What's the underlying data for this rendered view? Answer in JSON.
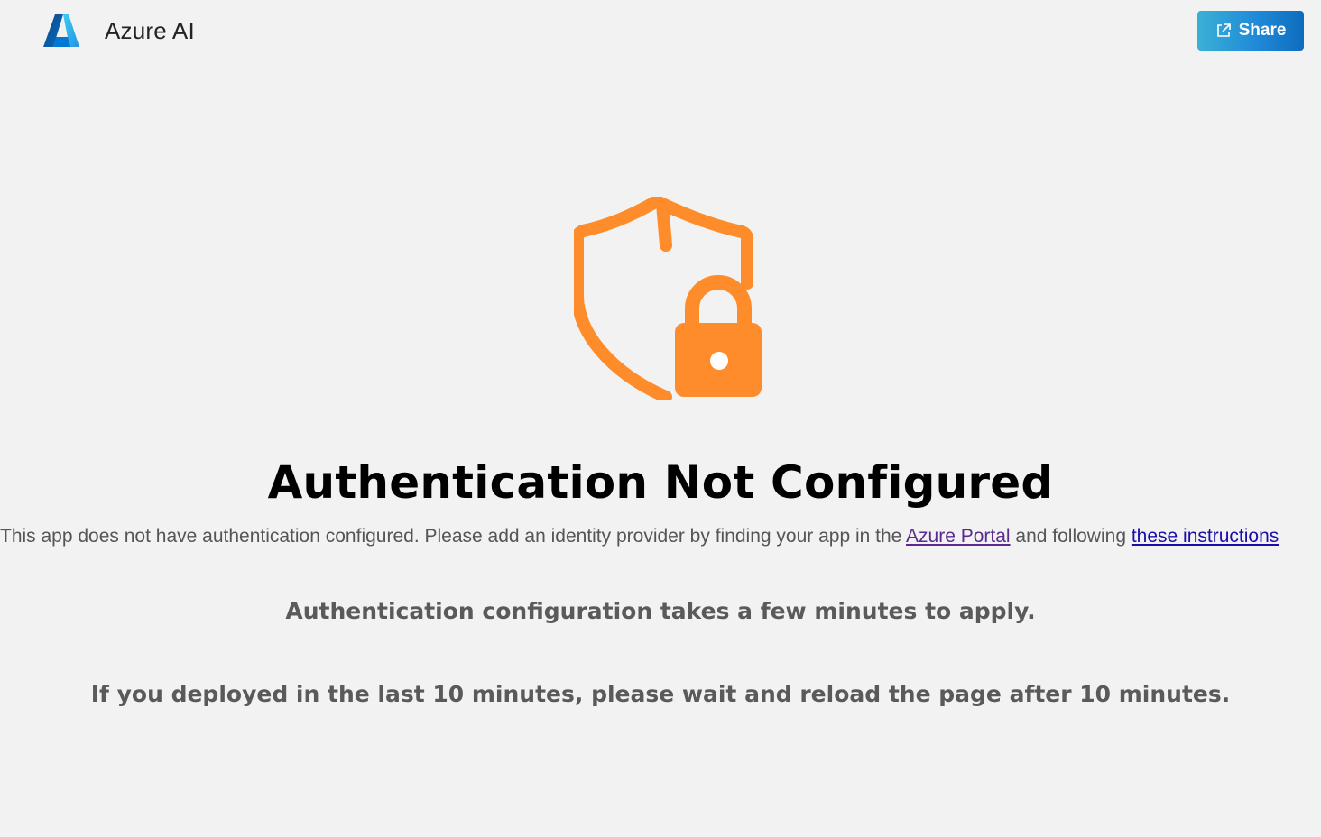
{
  "header": {
    "brand_title": "Azure AI",
    "logo_icon": "azure-logo-icon",
    "share_label": "Share",
    "share_icon": "share-icon",
    "share_colors": [
      "#3bb0d6",
      "#0f6cbd"
    ]
  },
  "main": {
    "icon": "shield-lock-icon",
    "icon_color": "#ff8c2a",
    "title": "Authentication Not Configured",
    "description": {
      "text_before": "This app does not have authentication configured. Please add an identity provider by finding your app in the ",
      "portal_link": "Azure Portal",
      "text_middle": " and following ",
      "instructions_link": "these instructions"
    },
    "note_apply": "Authentication configuration takes a few minutes to apply.",
    "note_wait": "If you deployed in the last 10 minutes, please wait and reload the page after 10 minutes."
  }
}
